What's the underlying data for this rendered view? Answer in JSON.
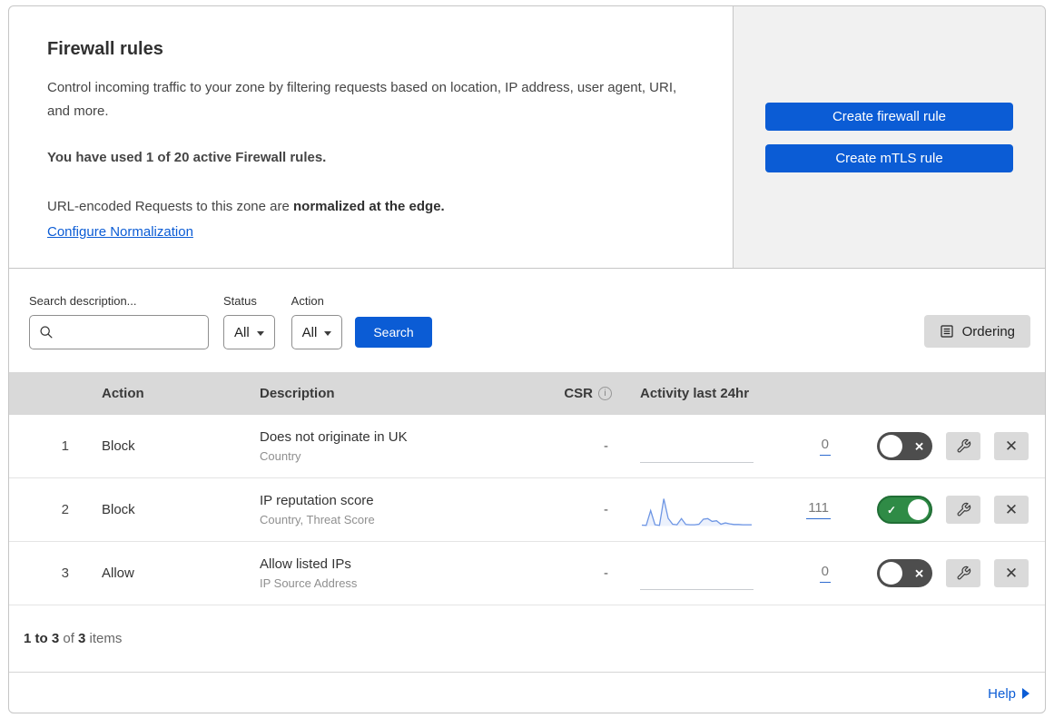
{
  "header": {
    "title": "Firewall rules",
    "description": "Control incoming traffic to your zone by filtering requests based on location, IP address, user agent, URI, and more.",
    "usage": "You have used 1 of 20 active Firewall rules.",
    "norm_prefix": "URL-encoded Requests to this zone are ",
    "norm_bold": "normalized at the edge.",
    "norm_link": "Configure Normalization",
    "btn_firewall": "Create firewall rule",
    "btn_mtls": "Create mTLS rule"
  },
  "filters": {
    "search_label": "Search description...",
    "search_value": "",
    "status_label": "Status",
    "status_value": "All",
    "action_label": "Action",
    "action_value": "All",
    "search_button": "Search",
    "ordering_button": "Ordering"
  },
  "table": {
    "columns": {
      "action": "Action",
      "description": "Description",
      "csr": "CSR",
      "csr_info": "i",
      "activity": "Activity last 24hr"
    },
    "rows": [
      {
        "number": "1",
        "action": "Block",
        "description": "Does not originate in UK",
        "fields": "Country",
        "csr": "-",
        "activity_count": "0",
        "enabled": false,
        "sparkline": null
      },
      {
        "number": "2",
        "action": "Block",
        "description": "IP reputation score",
        "fields": "Country, Threat Score",
        "csr": "-",
        "activity_count": "111",
        "enabled": true,
        "sparkline": [
          3,
          2,
          50,
          4,
          2,
          88,
          25,
          6,
          4,
          24,
          5,
          4,
          4,
          6,
          22,
          24,
          15,
          17,
          6,
          10,
          7,
          5,
          5,
          4,
          4,
          4
        ]
      },
      {
        "number": "3",
        "action": "Allow",
        "description": "Allow listed IPs",
        "fields": "IP Source Address",
        "csr": "-",
        "activity_count": "0",
        "enabled": false,
        "sparkline": null
      }
    ],
    "footer": {
      "range": "1 to 3",
      "of": " of ",
      "total": "3",
      "items": " items"
    }
  },
  "page_footer": {
    "help_label": "Help"
  },
  "icons": {
    "toggle_off_glyph": "✕",
    "toggle_on_glyph": "✓",
    "close_glyph": "✕"
  },
  "colors": {
    "accent_blue": "#0b5cd5",
    "toggle_on_green": "#2f8b46",
    "toggle_off_gray": "#4d4d4d",
    "header_band_gray": "#d9d9d9",
    "side_panel_gray": "#f1f1f1",
    "sparkline_blue": "#6e96e4",
    "count_underline_blue": "#2e6bd0"
  }
}
